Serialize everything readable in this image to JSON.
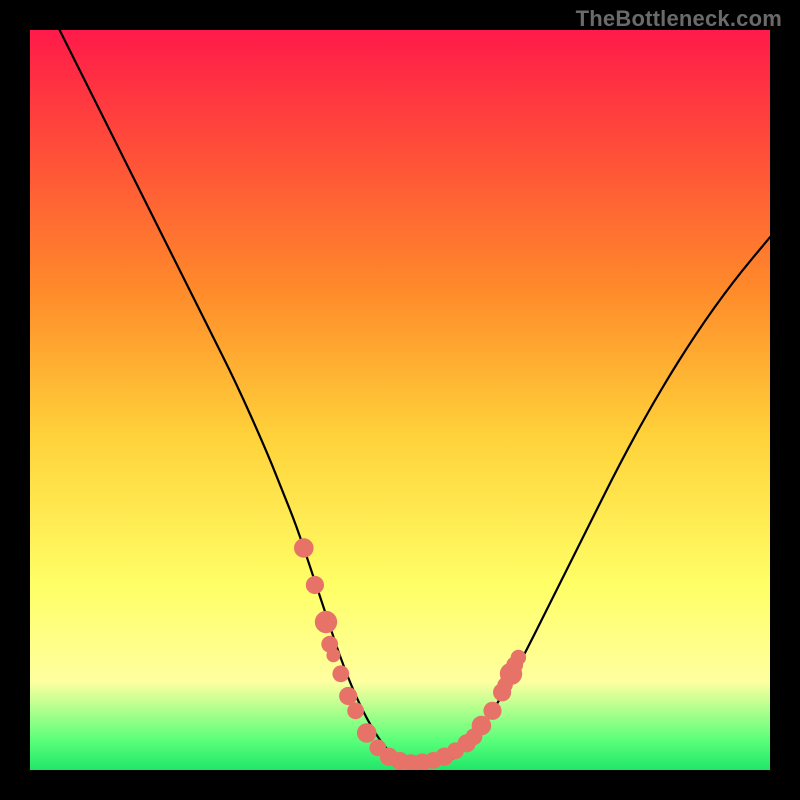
{
  "watermark": "TheBottleneck.com",
  "colors": {
    "gradient_stops": [
      {
        "pos": 0,
        "hex": "#ff1a4a"
      },
      {
        "pos": 15,
        "hex": "#ff4a3a"
      },
      {
        "pos": 35,
        "hex": "#ff8a2a"
      },
      {
        "pos": 55,
        "hex": "#ffd23a"
      },
      {
        "pos": 75,
        "hex": "#ffff66"
      },
      {
        "pos": 88,
        "hex": "#ffffa0"
      },
      {
        "pos": 96,
        "hex": "#5aff7a"
      },
      {
        "pos": 100,
        "hex": "#20e66a"
      }
    ],
    "curve_stroke": "#000000",
    "marker_fill": "#e77268",
    "frame_bg": "#000000"
  },
  "chart_data": {
    "type": "line",
    "title": "",
    "xlabel": "",
    "ylabel": "",
    "xlim": [
      0,
      100
    ],
    "ylim": [
      0,
      100
    ],
    "grid": false,
    "series": [
      {
        "name": "bottleneck-curve",
        "x": [
          4,
          8,
          12,
          16,
          20,
          24,
          28,
          32,
          34,
          36,
          38,
          40,
          42,
          44,
          46,
          48,
          50,
          52,
          54,
          56,
          58,
          60,
          62,
          66,
          70,
          75,
          80,
          85,
          90,
          95,
          100
        ],
        "y": [
          100,
          92,
          84,
          76,
          68,
          60,
          52,
          43,
          38,
          33,
          27,
          21,
          15,
          10,
          6,
          3,
          1,
          0.5,
          0.5,
          1,
          2,
          4,
          7,
          14,
          22,
          32,
          42,
          51,
          59,
          66,
          72
        ]
      }
    ],
    "markers": [
      {
        "x": 37,
        "y": 30,
        "r": 1.4
      },
      {
        "x": 38.5,
        "y": 25,
        "r": 1.3
      },
      {
        "x": 40,
        "y": 20,
        "r": 1.6
      },
      {
        "x": 40.5,
        "y": 17,
        "r": 1.2
      },
      {
        "x": 41,
        "y": 15.5,
        "r": 1.0
      },
      {
        "x": 42,
        "y": 13,
        "r": 1.2
      },
      {
        "x": 43,
        "y": 10,
        "r": 1.3
      },
      {
        "x": 44,
        "y": 8,
        "r": 1.2
      },
      {
        "x": 45.5,
        "y": 5,
        "r": 1.4
      },
      {
        "x": 47,
        "y": 3,
        "r": 1.2
      },
      {
        "x": 48.5,
        "y": 1.8,
        "r": 1.3
      },
      {
        "x": 50,
        "y": 1.2,
        "r": 1.3
      },
      {
        "x": 51.5,
        "y": 1.0,
        "r": 1.2
      },
      {
        "x": 53,
        "y": 1.0,
        "r": 1.3
      },
      {
        "x": 54.5,
        "y": 1.3,
        "r": 1.2
      },
      {
        "x": 56,
        "y": 1.8,
        "r": 1.3
      },
      {
        "x": 57.5,
        "y": 2.6,
        "r": 1.2
      },
      {
        "x": 59,
        "y": 3.6,
        "r": 1.3
      },
      {
        "x": 60,
        "y": 4.5,
        "r": 1.2
      },
      {
        "x": 61,
        "y": 6,
        "r": 1.4
      },
      {
        "x": 62.5,
        "y": 8,
        "r": 1.3
      },
      {
        "x": 63.8,
        "y": 10.5,
        "r": 1.3
      },
      {
        "x": 64.2,
        "y": 11.5,
        "r": 1.1
      },
      {
        "x": 65,
        "y": 13,
        "r": 1.6
      },
      {
        "x": 65.5,
        "y": 14.2,
        "r": 1.2
      },
      {
        "x": 66,
        "y": 15.2,
        "r": 1.1
      }
    ]
  }
}
